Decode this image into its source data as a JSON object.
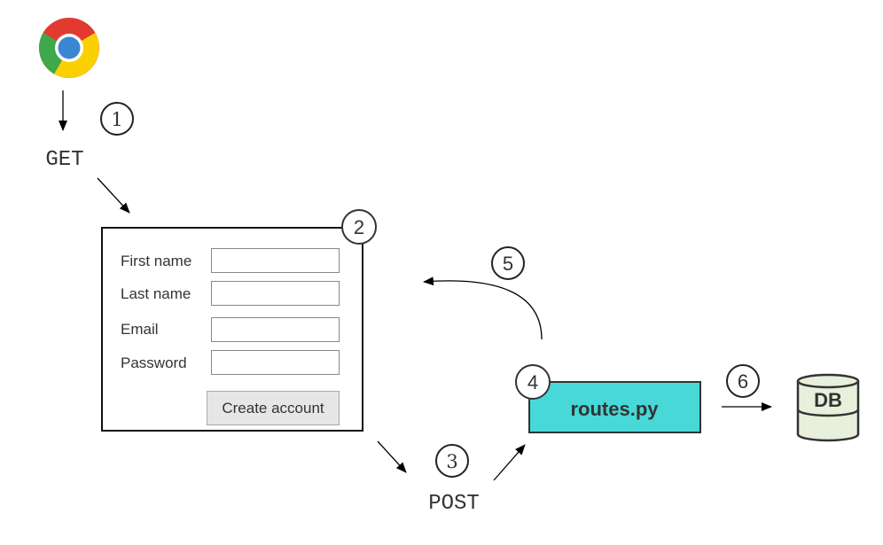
{
  "steps": {
    "s1": "1",
    "s2": "2",
    "s3": "3",
    "s4": "4",
    "s5": "5",
    "s6": "6"
  },
  "labels": {
    "get": "GET",
    "post": "POST",
    "routes": "routes.py",
    "db": "DB"
  },
  "form": {
    "fields": [
      {
        "label": "First name",
        "value": ""
      },
      {
        "label": "Last name",
        "value": ""
      },
      {
        "label": "Email",
        "value": ""
      },
      {
        "label": "Password",
        "value": ""
      }
    ],
    "submit_label": "Create account"
  },
  "icons": {
    "browser": "chrome-logo-icon",
    "database": "database-cylinder-icon"
  },
  "colors": {
    "routes_fill": "#48d8d8",
    "db_fill": "#e8f0dc",
    "stroke": "#333333"
  }
}
